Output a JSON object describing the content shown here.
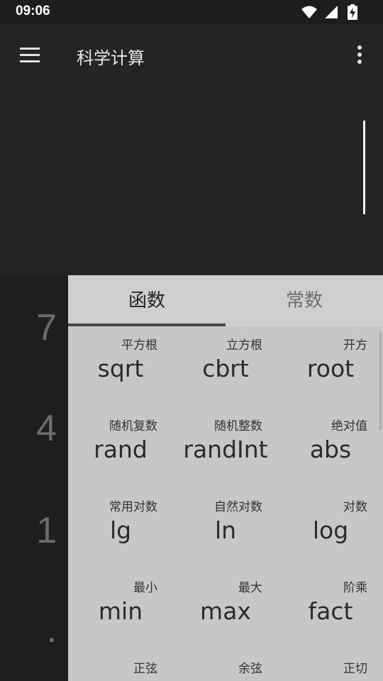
{
  "status_bar": {
    "time": "09:06"
  },
  "toolbar": {
    "title": "科学计算"
  },
  "keypad": {
    "keys": [
      "7",
      "4",
      "1",
      "."
    ]
  },
  "tabs": {
    "functions": "函数",
    "constants": "常数"
  },
  "functions": [
    {
      "label": "平方根",
      "name": "sqrt"
    },
    {
      "label": "立方根",
      "name": "cbrt"
    },
    {
      "label": "开方",
      "name": "root"
    },
    {
      "label": "随机复数",
      "name": "rand"
    },
    {
      "label": "随机整数",
      "name": "randInt"
    },
    {
      "label": "绝对值",
      "name": "abs"
    },
    {
      "label": "常用对数",
      "name": "lg"
    },
    {
      "label": "自然对数",
      "name": "ln"
    },
    {
      "label": "对数",
      "name": "log"
    },
    {
      "label": "最小",
      "name": "min"
    },
    {
      "label": "最大",
      "name": "max"
    },
    {
      "label": "阶乘",
      "name": "fact"
    },
    {
      "label": "正弦",
      "name": ""
    },
    {
      "label": "余弦",
      "name": ""
    },
    {
      "label": "正切",
      "name": ""
    }
  ]
}
